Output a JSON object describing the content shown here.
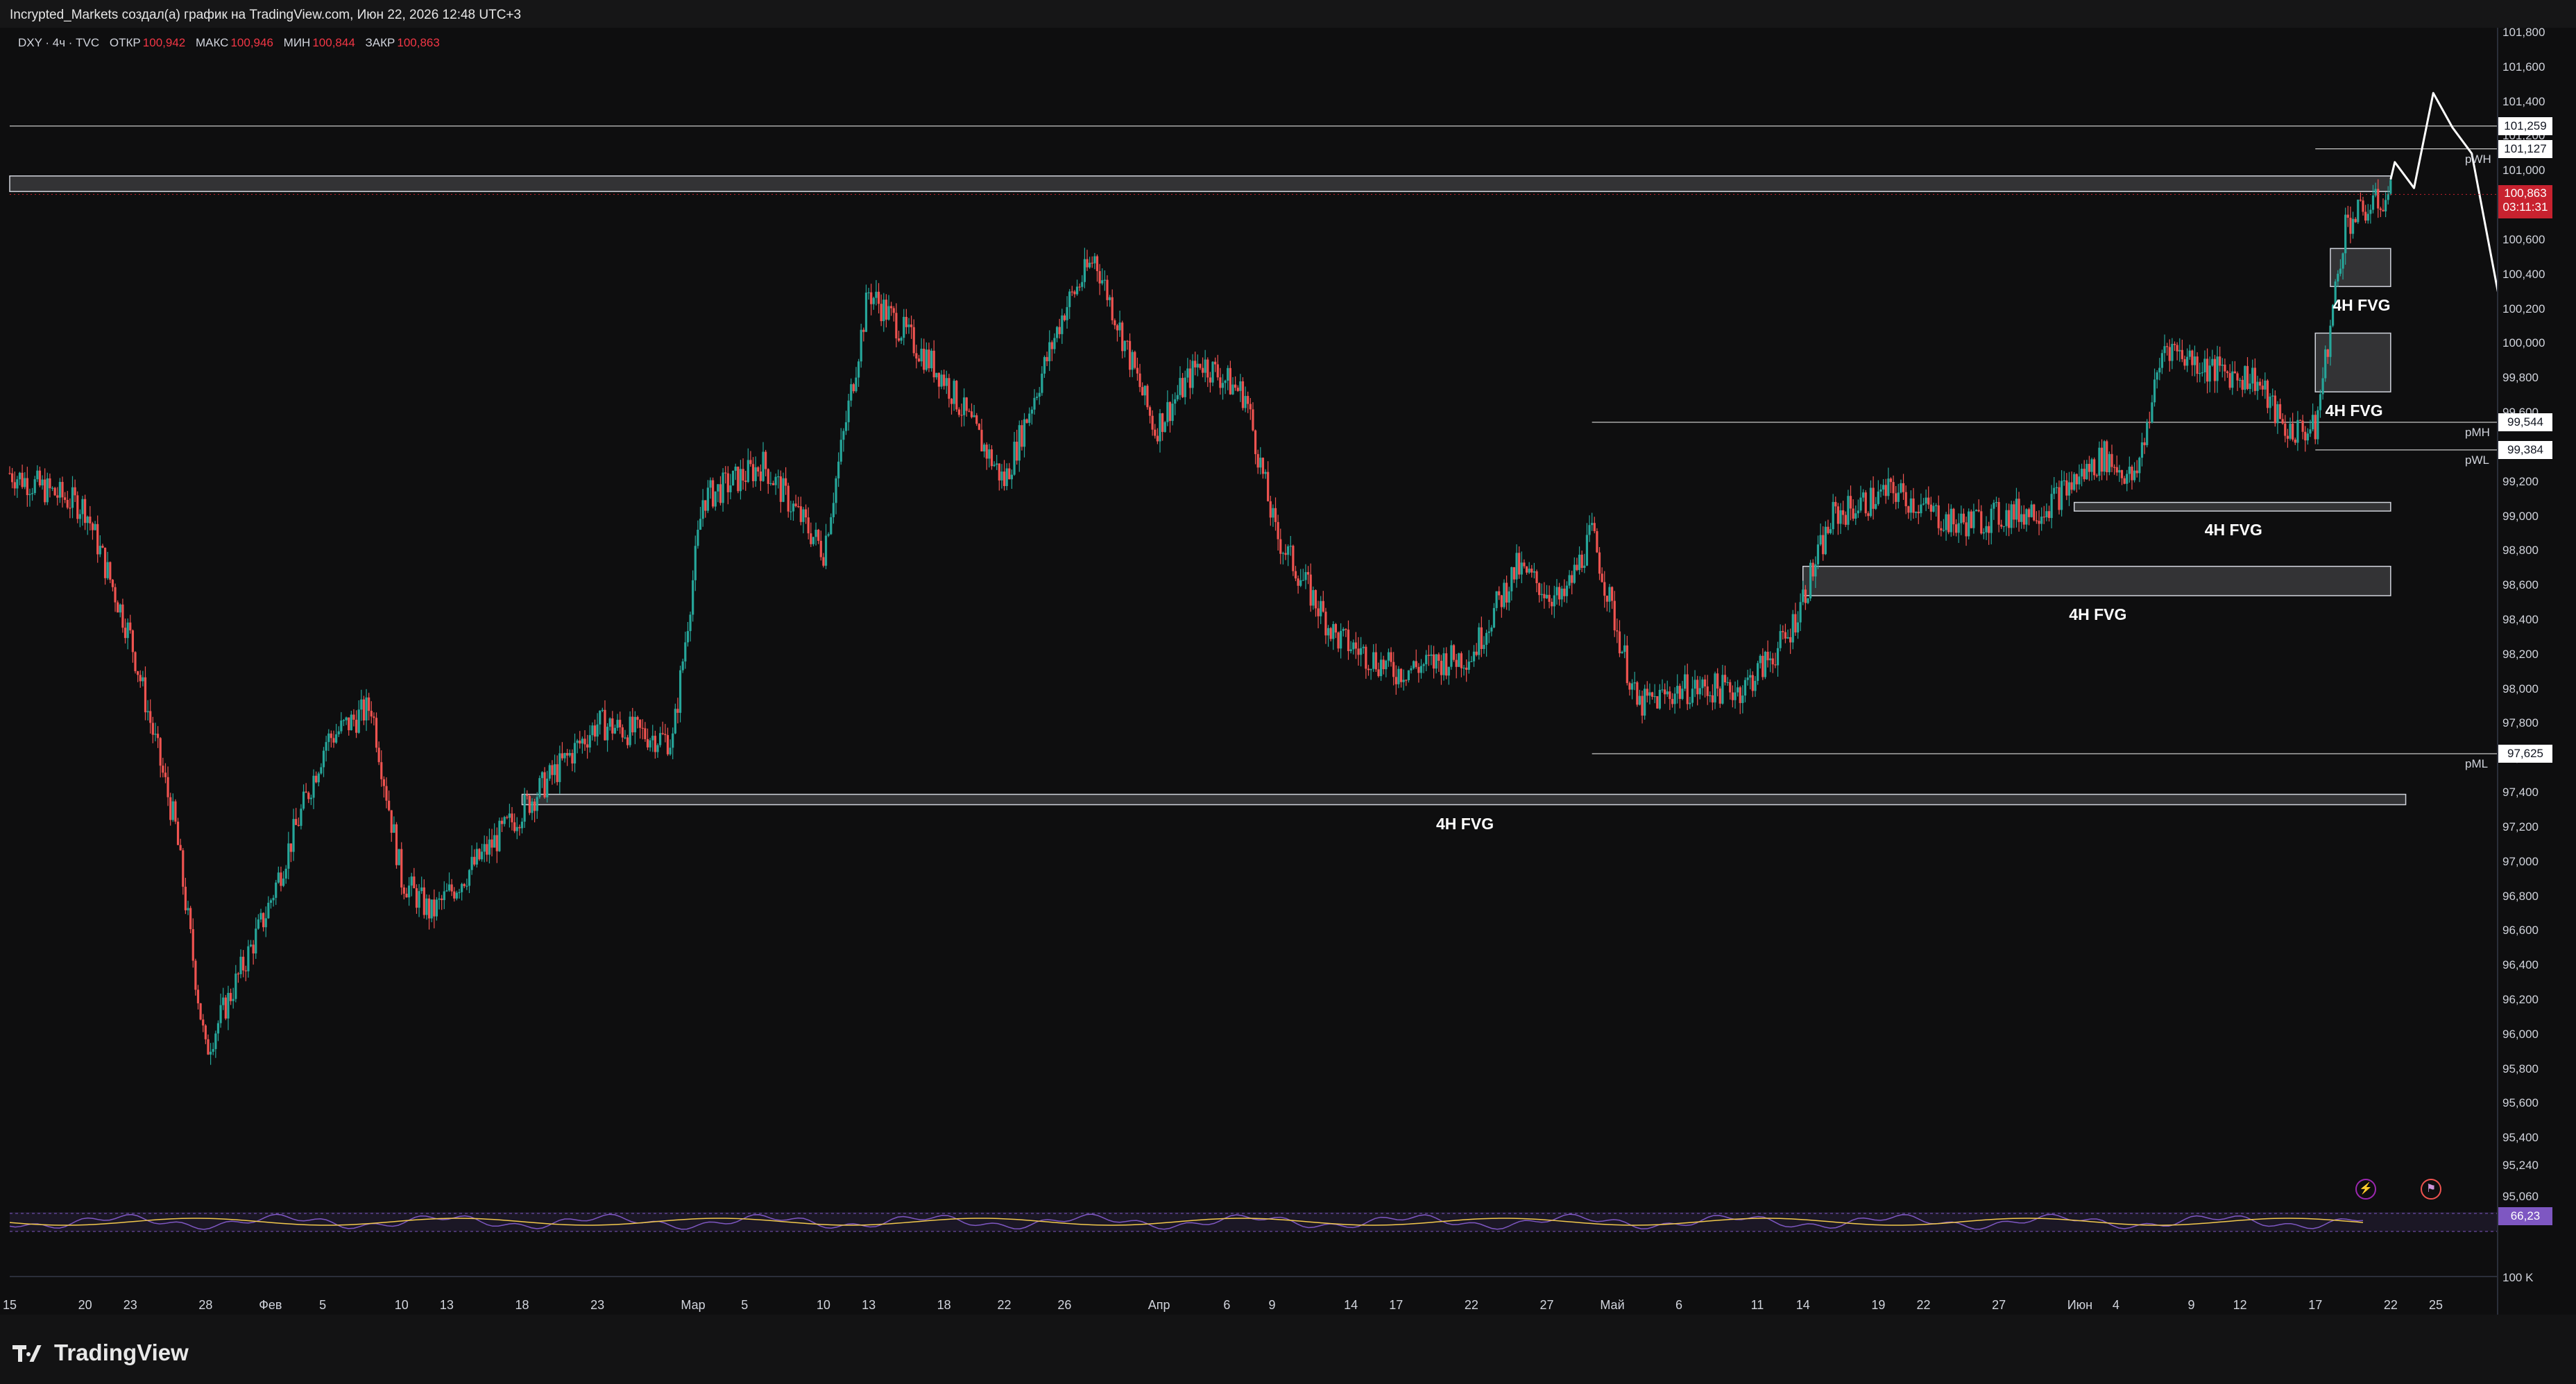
{
  "header": {
    "attribution": "Incrypted_Markets создал(а) график на TradingView.com, Июн 22, 2026 12:48 UTC+3"
  },
  "legend": {
    "symbol": "DXY · 4ч · TVC",
    "open_label": "ОТКР",
    "open": "100,942",
    "high_label": "МАКС",
    "high": "100,946",
    "low_label": "МИН",
    "low": "100,844",
    "close_label": "ЗАКР",
    "close": "100,863"
  },
  "colors": {
    "up": "#26a69a",
    "down": "#ef5350",
    "background": "#0e0e0f",
    "current_price": "#c8222f",
    "rsi": "#7e57c2",
    "rsi_ma": "#f2c94c"
  },
  "chart_data": {
    "type": "candlestick",
    "symbol": "DXY",
    "timeframe": "4H",
    "ylim": [
      95060,
      101800
    ],
    "y_ticks": [
      "101,800",
      "101,600",
      "101,400",
      "101,200",
      "101,000",
      "100,800",
      "100,600",
      "100,400",
      "100,200",
      "100,000",
      "99,800",
      "99,600",
      "99,400",
      "99,200",
      "99,000",
      "98,800",
      "98,600",
      "98,400",
      "98,200",
      "98,000",
      "97,800",
      "97,600",
      "97,400",
      "97,200",
      "97,000",
      "96,800",
      "96,600",
      "96,400",
      "96,200",
      "96,000",
      "95,800",
      "95,600",
      "95,400",
      "95,240",
      "95,060"
    ],
    "x_ticks": [
      "15",
      "20",
      "23",
      "28",
      "Фев",
      "5",
      "10",
      "13",
      "18",
      "23",
      "Мар",
      "5",
      "10",
      "13",
      "18",
      "22",
      "26",
      "Апр",
      "6",
      "9",
      "14",
      "17",
      "22",
      "27",
      "Май",
      "6",
      "11",
      "14",
      "19",
      "22",
      "27",
      "Июн",
      "4",
      "9",
      "12",
      "17",
      "22",
      "25"
    ],
    "price_path": [
      {
        "date": "Jan 15",
        "close": 99250
      },
      {
        "date": "Jan 20",
        "close": 99050
      },
      {
        "date": "Jan 23",
        "close": 98300
      },
      {
        "date": "Jan 26",
        "close": 97200
      },
      {
        "date": "Jan 28",
        "close": 95900
      },
      {
        "date": "Feb 1",
        "close": 96700
      },
      {
        "date": "Feb 5",
        "close": 97700
      },
      {
        "date": "Feb 8",
        "close": 97900
      },
      {
        "date": "Feb 10",
        "close": 96900
      },
      {
        "date": "Feb 12",
        "close": 96700
      },
      {
        "date": "Feb 18",
        "close": 97300
      },
      {
        "date": "Feb 23",
        "close": 97800
      },
      {
        "date": "Feb 28",
        "close": 97700
      },
      {
        "date": "Mar 2",
        "close": 99100
      },
      {
        "date": "Mar 6",
        "close": 99300
      },
      {
        "date": "Mar 10",
        "close": 98800
      },
      {
        "date": "Mar 13",
        "close": 100300
      },
      {
        "date": "Mar 18",
        "close": 99800
      },
      {
        "date": "Mar 22",
        "close": 99200
      },
      {
        "date": "Mar 26",
        "close": 100200
      },
      {
        "date": "Mar 28",
        "close": 100500
      },
      {
        "date": "Apr 1",
        "close": 99500
      },
      {
        "date": "Apr 4",
        "close": 99900
      },
      {
        "date": "Apr 7",
        "close": 99700
      },
      {
        "date": "Apr 9",
        "close": 98900
      },
      {
        "date": "Apr 13",
        "close": 98300
      },
      {
        "date": "Apr 17",
        "close": 98100
      },
      {
        "date": "Apr 22",
        "close": 98200
      },
      {
        "date": "Apr 25",
        "close": 98700
      },
      {
        "date": "Apr 28",
        "close": 98500
      },
      {
        "date": "Apr 30",
        "close": 98900
      },
      {
        "date": "May 3",
        "close": 97900
      },
      {
        "date": "May 6",
        "close": 98000
      },
      {
        "date": "May 10",
        "close": 98000
      },
      {
        "date": "May 13",
        "close": 98300
      },
      {
        "date": "May 16",
        "close": 99000
      },
      {
        "date": "May 20",
        "close": 99150
      },
      {
        "date": "May 24",
        "close": 98950
      },
      {
        "date": "May 30",
        "close": 99050
      },
      {
        "date": "Jun 3",
        "close": 99350
      },
      {
        "date": "Jun 5",
        "close": 99200
      },
      {
        "date": "Jun 7",
        "close": 100000
      },
      {
        "date": "Jun 10",
        "close": 99850
      },
      {
        "date": "Jun 13",
        "close": 99800
      },
      {
        "date": "Jun 15",
        "close": 99500
      },
      {
        "date": "Jun 17",
        "close": 99500
      },
      {
        "date": "Jun 19",
        "close": 100700
      },
      {
        "date": "Jun 22",
        "close": 100863
      }
    ],
    "levels": [
      {
        "value": 101259,
        "tag": "101,259"
      },
      {
        "value": 101127,
        "tag": "101,127",
        "label": "pWH"
      },
      {
        "value": 99544,
        "tag": "99,544",
        "label": "pMH"
      },
      {
        "value": 99384,
        "tag": "99,384",
        "label": "pWL"
      },
      {
        "value": 97625,
        "tag": "97,625",
        "label": "pML"
      }
    ],
    "current_price": {
      "value": 100863,
      "tag": "100,863",
      "timer": "03:11:31"
    },
    "zones": [
      {
        "top": 100970,
        "bottom": 100880,
        "from": "Jan 15",
        "to": "Jun 22"
      },
      {
        "top": 100550,
        "bottom": 100330,
        "from": "Jun 18",
        "to": "Jun 22",
        "label": "4H FVG"
      },
      {
        "top": 100060,
        "bottom": 99720,
        "from": "Jun 17",
        "to": "Jun 22",
        "label": "4H FVG"
      },
      {
        "top": 99080,
        "bottom": 99030,
        "from": "Jun 1",
        "to": "Jun 22",
        "label": "4H FVG"
      },
      {
        "top": 98710,
        "bottom": 98540,
        "from": "May 14",
        "to": "Jun 22",
        "label": "4H FVG"
      },
      {
        "top": 97390,
        "bottom": 97330,
        "from": "Feb 18",
        "to": "Jun 23",
        "label": "4H FVG"
      }
    ],
    "projection": [
      {
        "date": "Jun 22",
        "close": 100950
      },
      {
        "date": "Jun 22",
        "close": 101050
      },
      {
        "date": "Jun 23",
        "close": 100900
      },
      {
        "date": "Jun 24",
        "close": 101450
      },
      {
        "date": "Jun 25",
        "close": 101250
      },
      {
        "date": "Jun 26",
        "close": 101100
      },
      {
        "date": "Jun 28",
        "close": 100050
      }
    ],
    "rsi": {
      "value": "66,23"
    },
    "volume_scale": "100 K"
  },
  "footer": {
    "brand": "TradingView"
  }
}
